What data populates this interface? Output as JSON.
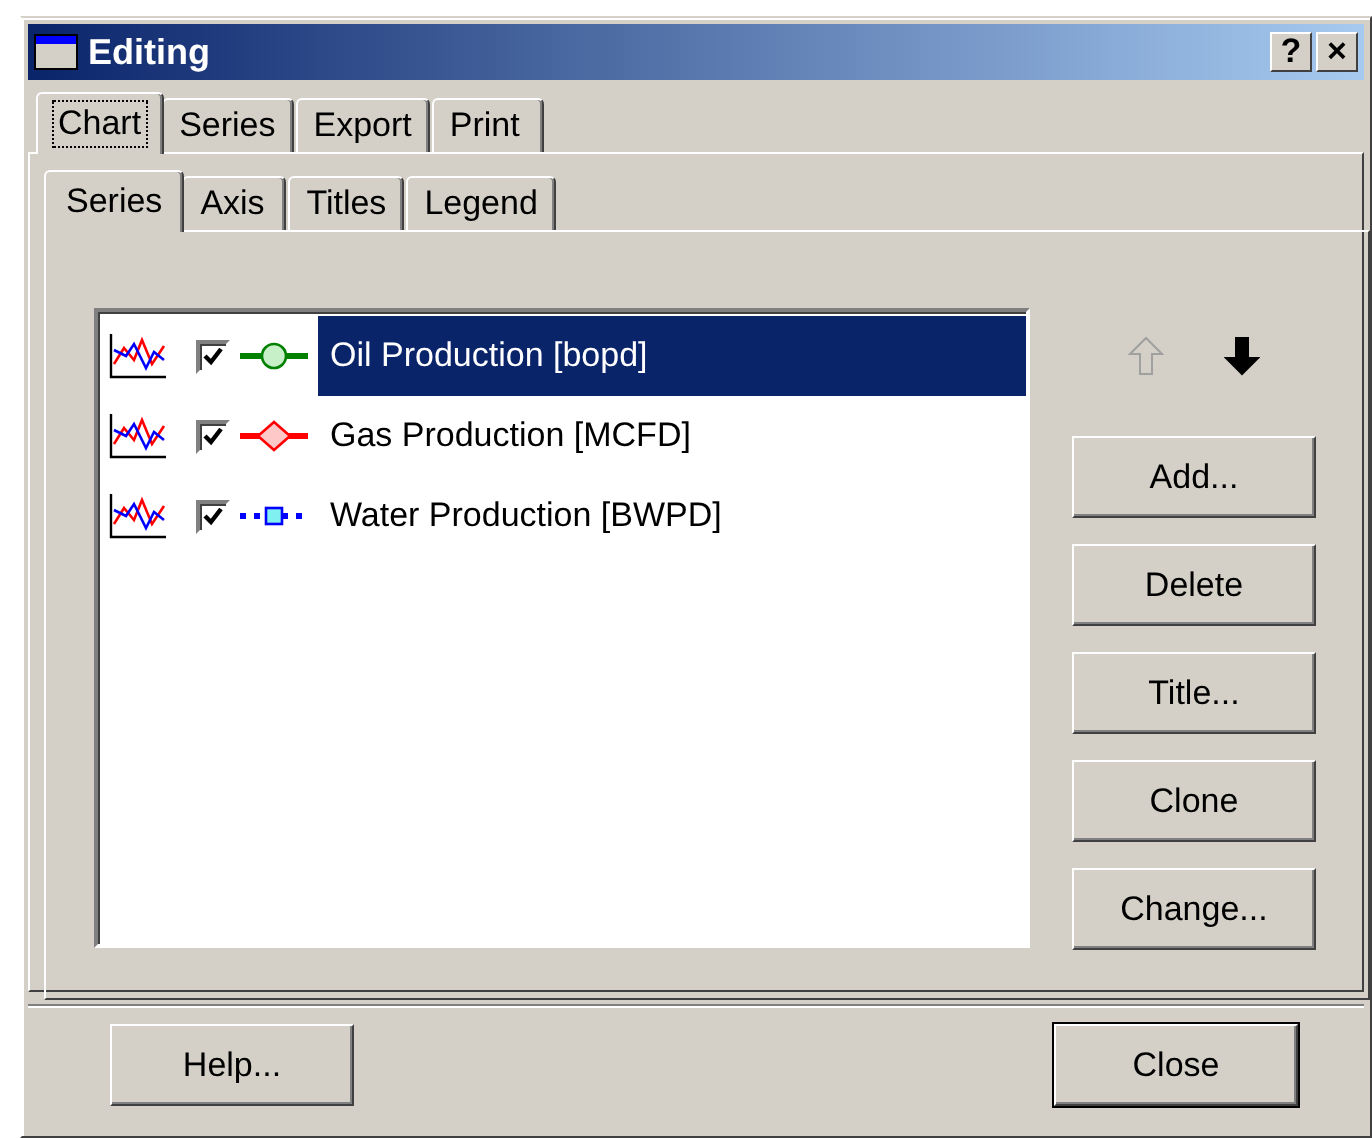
{
  "window": {
    "title": "Editing",
    "help_button": "?",
    "close_button": "×"
  },
  "tabs": [
    {
      "label": "Chart",
      "selected": true
    },
    {
      "label": "Series",
      "selected": false
    },
    {
      "label": "Export",
      "selected": false
    },
    {
      "label": "Print",
      "selected": false
    }
  ],
  "sub_tabs": [
    {
      "label": "Series",
      "selected": true
    },
    {
      "label": "Axis",
      "selected": false
    },
    {
      "label": "Titles",
      "selected": false
    },
    {
      "label": "Legend",
      "selected": false
    }
  ],
  "series": [
    {
      "name": "Oil Production [bopd]",
      "checked": true,
      "selected": true,
      "kind": "circle",
      "color": "#008000"
    },
    {
      "name": "Gas Production [MCFD]",
      "checked": true,
      "selected": false,
      "kind": "diamond",
      "color": "#ff0000"
    },
    {
      "name": "Water Production [BWPD]",
      "checked": true,
      "selected": false,
      "kind": "square",
      "color": "#0000ff"
    }
  ],
  "move_buttons": [
    {
      "kind": "up",
      "disabled": true
    },
    {
      "kind": "down",
      "disabled": false
    }
  ],
  "buttons": [
    {
      "label": "Add..."
    },
    {
      "label": "Delete"
    },
    {
      "label": "Title..."
    },
    {
      "label": "Clone"
    },
    {
      "label": "Change..."
    }
  ],
  "footer_buttons": [
    {
      "label": "Help...",
      "default": false
    },
    {
      "label": "Close",
      "default": true
    }
  ]
}
